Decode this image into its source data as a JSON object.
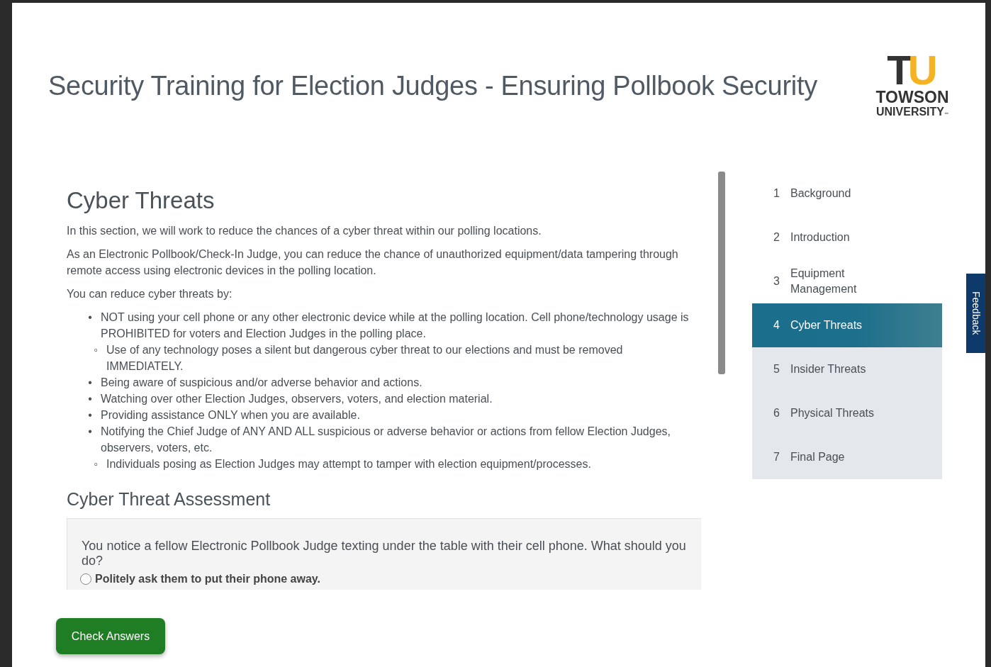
{
  "header": {
    "title": "Security Training for Election Judges - Ensuring Pollbook Security",
    "logo": {
      "mark_left": "T",
      "mark_right": "U",
      "line1": "TOWSON",
      "line2": "UNIVERSITY",
      "trademark": "™"
    }
  },
  "section": {
    "heading": "Cyber Threats",
    "paragraphs": [
      "In this section, we will work to reduce the chances of a cyber threat within our polling locations.",
      "As an Electronic Pollbook/Check-In Judge, you can reduce the chance of unauthorized equipment/data tampering through remote access using electronic devices in the polling location.",
      "You can reduce cyber threats by:"
    ],
    "bullets": [
      {
        "marker": "•",
        "text": "NOT using your cell phone or any other electronic device while at the polling location. Cell phone/technology usage is PROHIBITED for voters and Election Judges in the polling place.",
        "children": [
          {
            "marker": "◦",
            "text": "Use of any technology poses a silent but dangerous cyber threat to our elections and must be removed IMMEDIATELY."
          }
        ]
      },
      {
        "marker": "•",
        "text": "Being aware of suspicious and/or adverse behavior and actions."
      },
      {
        "marker": "•",
        "text": "Watching over other Election Judges, observers, voters, and election material."
      },
      {
        "marker": "•",
        "text": "Providing assistance ONLY when you are available."
      },
      {
        "marker": "•",
        "text": "Notifying the Chief Judge of ANY AND ALL suspicious or adverse behavior or actions from fellow Election Judges, observers, voters, etc.",
        "children": [
          {
            "marker": "◦",
            "text": "Individuals posing as Election Judges may attempt to tamper with election equipment/processes."
          }
        ]
      }
    ]
  },
  "assessment": {
    "heading": "Cyber Threat Assessment",
    "question": "You notice a fellow Electronic Pollbook Judge texting under the table with their cell phone. What should you do?",
    "options": [
      {
        "label": "Politely ask them to put their phone away.",
        "selected": false
      }
    ]
  },
  "nav": [
    {
      "number": "1",
      "label": "Background",
      "selected": false,
      "visited": true
    },
    {
      "number": "2",
      "label": "Introduction",
      "selected": false,
      "visited": true
    },
    {
      "number": "3",
      "label": "Equipment Management",
      "selected": false,
      "visited": true
    },
    {
      "number": "4",
      "label": "Cyber Threats",
      "selected": true,
      "visited": true
    },
    {
      "number": "5",
      "label": "Insider Threats",
      "selected": false,
      "visited": false
    },
    {
      "number": "6",
      "label": "Physical Threats",
      "selected": false,
      "visited": false
    },
    {
      "number": "7",
      "label": "Final Page",
      "selected": false,
      "visited": false
    }
  ],
  "feedback_tab": "Feedback",
  "check_button": "Check Answers"
}
